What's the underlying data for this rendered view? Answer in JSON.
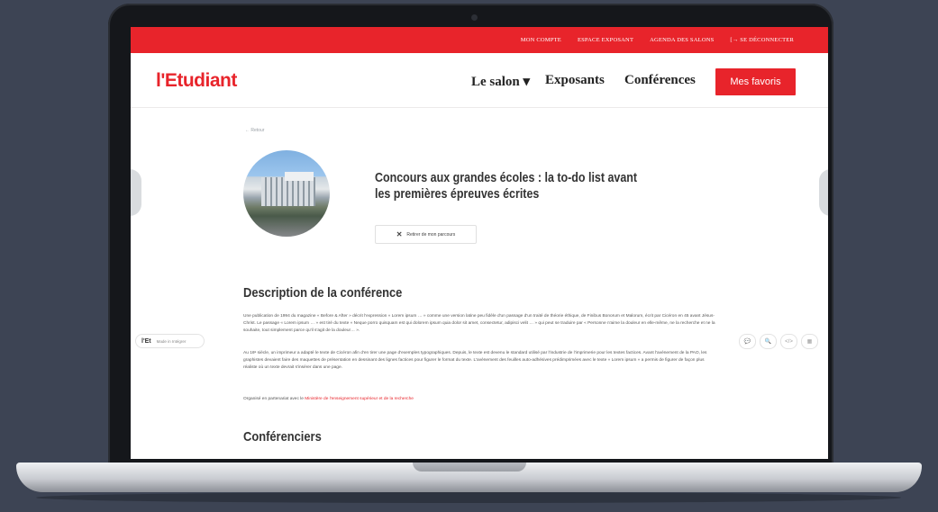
{
  "topbar": {
    "links": [
      "MON COMPTE",
      "ESPACE EXPOSANT",
      "AGENDA DES SALONS",
      "[→ SE DÉCONNECTER"
    ]
  },
  "header": {
    "logo": "l'Etudiant",
    "nav": [
      "Le salon ▾",
      "Exposants",
      "Conférences"
    ],
    "favorites_button": "Mes favoris"
  },
  "conference": {
    "back_label": "← Retour",
    "title": "Concours aux grandes écoles : la to-do list avant les premières épreuves écrites",
    "remove_button": "Retirer de mon parcours",
    "description_heading": "Description de la conférence",
    "description_p1": "Une publication de 1994 du magazine « Before & After » décrit l'expression « Lorem ipsum … » comme une version latine peu fidèle d'un passage d'un traité de théorie éthique, de Finibus Bonorum et Malorum, écrit par Cicéron en 45 avant Jésus-Christ. Le passage « Lorem ipsum … » est tiré du texte « Neque porro quisquam est qui dolorem ipsum quia dolor sit amet, consectetur, adipisci velit … » qui peut se traduire par « Personne n'aime la douleur en elle-même, ne la recherche et ne la souhaite, tout simplement parce qu'il s'agit de la douleur… ».",
    "description_p2": "Au 16ᵉ siècle, un imprimeur a adapté le texte de Cicéron afin d'en tirer une page d'exemples typographiques. Depuis, le texte est devenu le standard utilisé par l'industrie de l'imprimerie pour les textes factices. Avant l'avènement de la PAO, les graphistes devaient faire des maquettes de présentation en dessinant des lignes factices pour figurer le format du texte. L'avènement des feuilles auto-adhésives prédimprimées avec le texte « Lorem ipsum » a permis de figurer de façon plus réaliste où un texte devrait s'insérer dans une page.",
    "organized_prefix": "Organisé en partenariat avec le ",
    "organized_link": "Ministère de l'enseignement supérieur et de la recherche",
    "speakers_heading": "Conférenciers"
  },
  "widget": {
    "logo": "l'Et",
    "label": "Made in Intégrer"
  },
  "tools": [
    "💬",
    "🔍",
    "</>",
    "▦"
  ],
  "colors": {
    "brand": "#e8242b",
    "device_bg": "#3d4454"
  }
}
